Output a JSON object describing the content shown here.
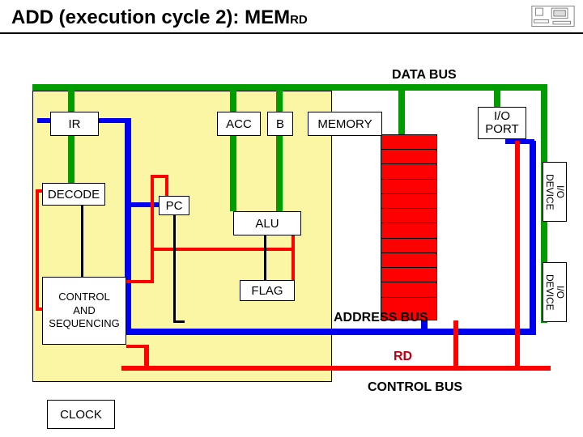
{
  "title": {
    "main": "ADD (execution cycle 2): MEM",
    "sub": "RD"
  },
  "labels": {
    "data_bus": "DATA BUS",
    "ir": "IR",
    "acc": "ACC",
    "b": "B",
    "memory": "MEMORY",
    "io_port": "I/O\nPORT",
    "decode": "DECODE",
    "pc": "PC",
    "alu": "ALU",
    "flag": "FLAG",
    "cas": "CONTROL\nAND\nSEQUENCING",
    "addr_bus": "ADDRESS BUS",
    "rd": "RD",
    "ctrl_bus": "CONTROL BUS",
    "clock": "CLOCK",
    "io_device": "I/O\nDEVICE"
  },
  "buses": {
    "data": {
      "color": "green",
      "thick": 8
    },
    "address": {
      "color": "blue",
      "thick": 8
    },
    "control": {
      "color": "red",
      "thick": 6
    }
  },
  "memory_rows": 12
}
